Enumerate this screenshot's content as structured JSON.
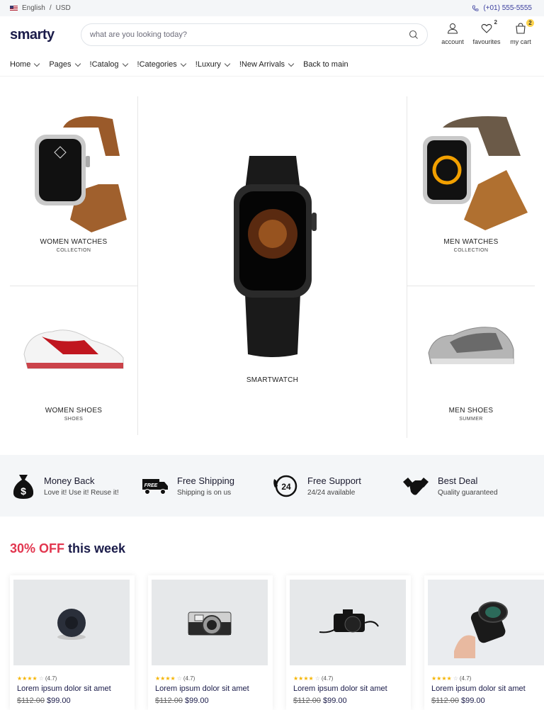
{
  "topbar": {
    "language": "English",
    "separator": "/",
    "currency": "USD",
    "phone": "(+01) 555-5555"
  },
  "header": {
    "logo": "smarty",
    "search_placeholder": "what are you looking today?",
    "account": "account",
    "favourites": "favourites",
    "favourites_count": "2",
    "cart": "my cart",
    "cart_count": "2"
  },
  "nav": {
    "items": [
      "Home",
      "Pages",
      "!Catalog",
      "!Categories",
      "!Luxury",
      "!New Arrivals",
      "Back to main"
    ]
  },
  "hero": {
    "women_watches": {
      "title": "WOMEN WATCHES",
      "sub": "COLLECTION"
    },
    "women_shoes": {
      "title": "WOMEN SHOES",
      "sub": "SHOES"
    },
    "smartwatch": {
      "title": "SMARTWATCH"
    },
    "men_watches": {
      "title": "MEN WATCHES",
      "sub": "COLLECTION"
    },
    "men_shoes": {
      "title": "MEN SHOES",
      "sub": "SUMMER"
    }
  },
  "features": [
    {
      "title": "Money Back",
      "sub": "Love it! Use it! Reuse it!",
      "icon": "money-bag-icon"
    },
    {
      "title": "Free Shipping",
      "sub": "Shipping is on us",
      "icon": "truck-icon",
      "badge": "FREE"
    },
    {
      "title": "Free Support",
      "sub": "24/24 available",
      "icon": "support-24-icon",
      "badge": "24"
    },
    {
      "title": "Best Deal",
      "sub": "Quality guaranteed",
      "icon": "handshake-icon"
    }
  ],
  "offer": {
    "highlight": "30% OFF",
    "rest": " this week"
  },
  "products": [
    {
      "rating": "(4.7)",
      "name": "Lorem ipsum dolor sit amet",
      "old_price": "$112.00",
      "price": "$99.00",
      "icon": "speaker-icon"
    },
    {
      "rating": "(4.7)",
      "name": "Lorem ipsum dolor sit amet",
      "old_price": "$112.00",
      "price": "$99.00",
      "icon": "camera-icon"
    },
    {
      "rating": "(4.7)",
      "name": "Lorem ipsum dolor sit amet",
      "old_price": "$112.00",
      "price": "$99.00",
      "icon": "dslr-camera-icon"
    },
    {
      "rating": "(4.7)",
      "name": "Lorem ipsum dolor sit amet",
      "old_price": "$112.00",
      "price": "$99.00",
      "icon": "lens-icon"
    }
  ],
  "colors": {
    "accent": "#e2364f",
    "brand": "#1b1c4a",
    "badge": "#fcd34d",
    "star": "#f5b400"
  }
}
